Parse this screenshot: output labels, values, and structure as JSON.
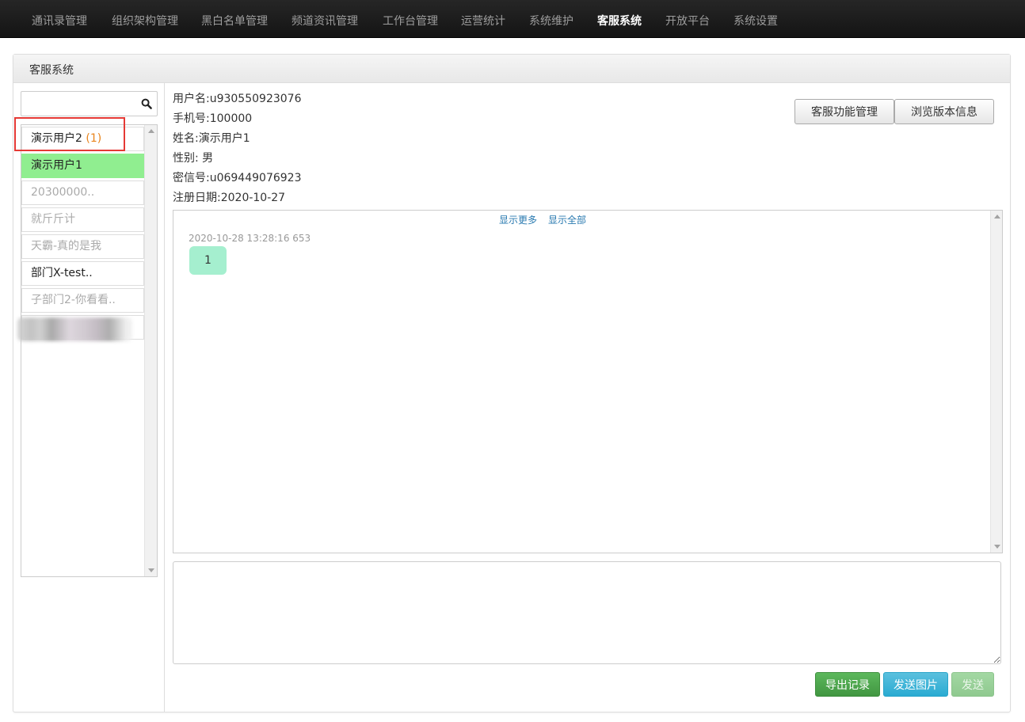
{
  "nav": {
    "items": [
      {
        "label": "通讯录管理"
      },
      {
        "label": "组织架构管理"
      },
      {
        "label": "黑白名单管理"
      },
      {
        "label": "频道资讯管理"
      },
      {
        "label": "工作台管理"
      },
      {
        "label": "运营统计"
      },
      {
        "label": "系统维护"
      },
      {
        "label": "客服系统",
        "active": true
      },
      {
        "label": "开放平台"
      },
      {
        "label": "系统设置"
      }
    ]
  },
  "panel": {
    "title": "客服系统"
  },
  "search": {
    "value": "",
    "placeholder": ""
  },
  "users": [
    {
      "name": "演示用户2",
      "badge": "(1)"
    },
    {
      "name": "演示用户1",
      "active": true
    },
    {
      "name": "20300000.."
    },
    {
      "name": "就斤斤计"
    },
    {
      "name": "天霸-真的是我"
    },
    {
      "name": "部门X-test.."
    },
    {
      "name": "子部门2-你看看.."
    }
  ],
  "info": {
    "username": "用户名:u930550923076",
    "phone": "手机号:100000",
    "name": "姓名:演示用户1",
    "gender": "性别: 男",
    "mixin": "密信号:u069449076923",
    "register": "注册日期:2020-10-27"
  },
  "actions": {
    "service_manage": "客服功能管理",
    "version_info": "浏览版本信息"
  },
  "chat": {
    "show_more": "显示更多",
    "show_all": "显示全部",
    "messages": [
      {
        "time": "2020-10-28 13:28:16 653",
        "text": "1"
      }
    ]
  },
  "compose": {
    "value": ""
  },
  "buttons": {
    "export": "导出记录",
    "send_image": "发送图片",
    "send": "发送"
  },
  "colors": {
    "nav_bg": "#1b1b1b",
    "active_user": "#90ee90",
    "badge": "#e8841c",
    "highlight": "#e53935",
    "bubble": "#a5efcf",
    "link": "#2a7ab0"
  },
  "icons": {
    "search": "search-icon"
  }
}
